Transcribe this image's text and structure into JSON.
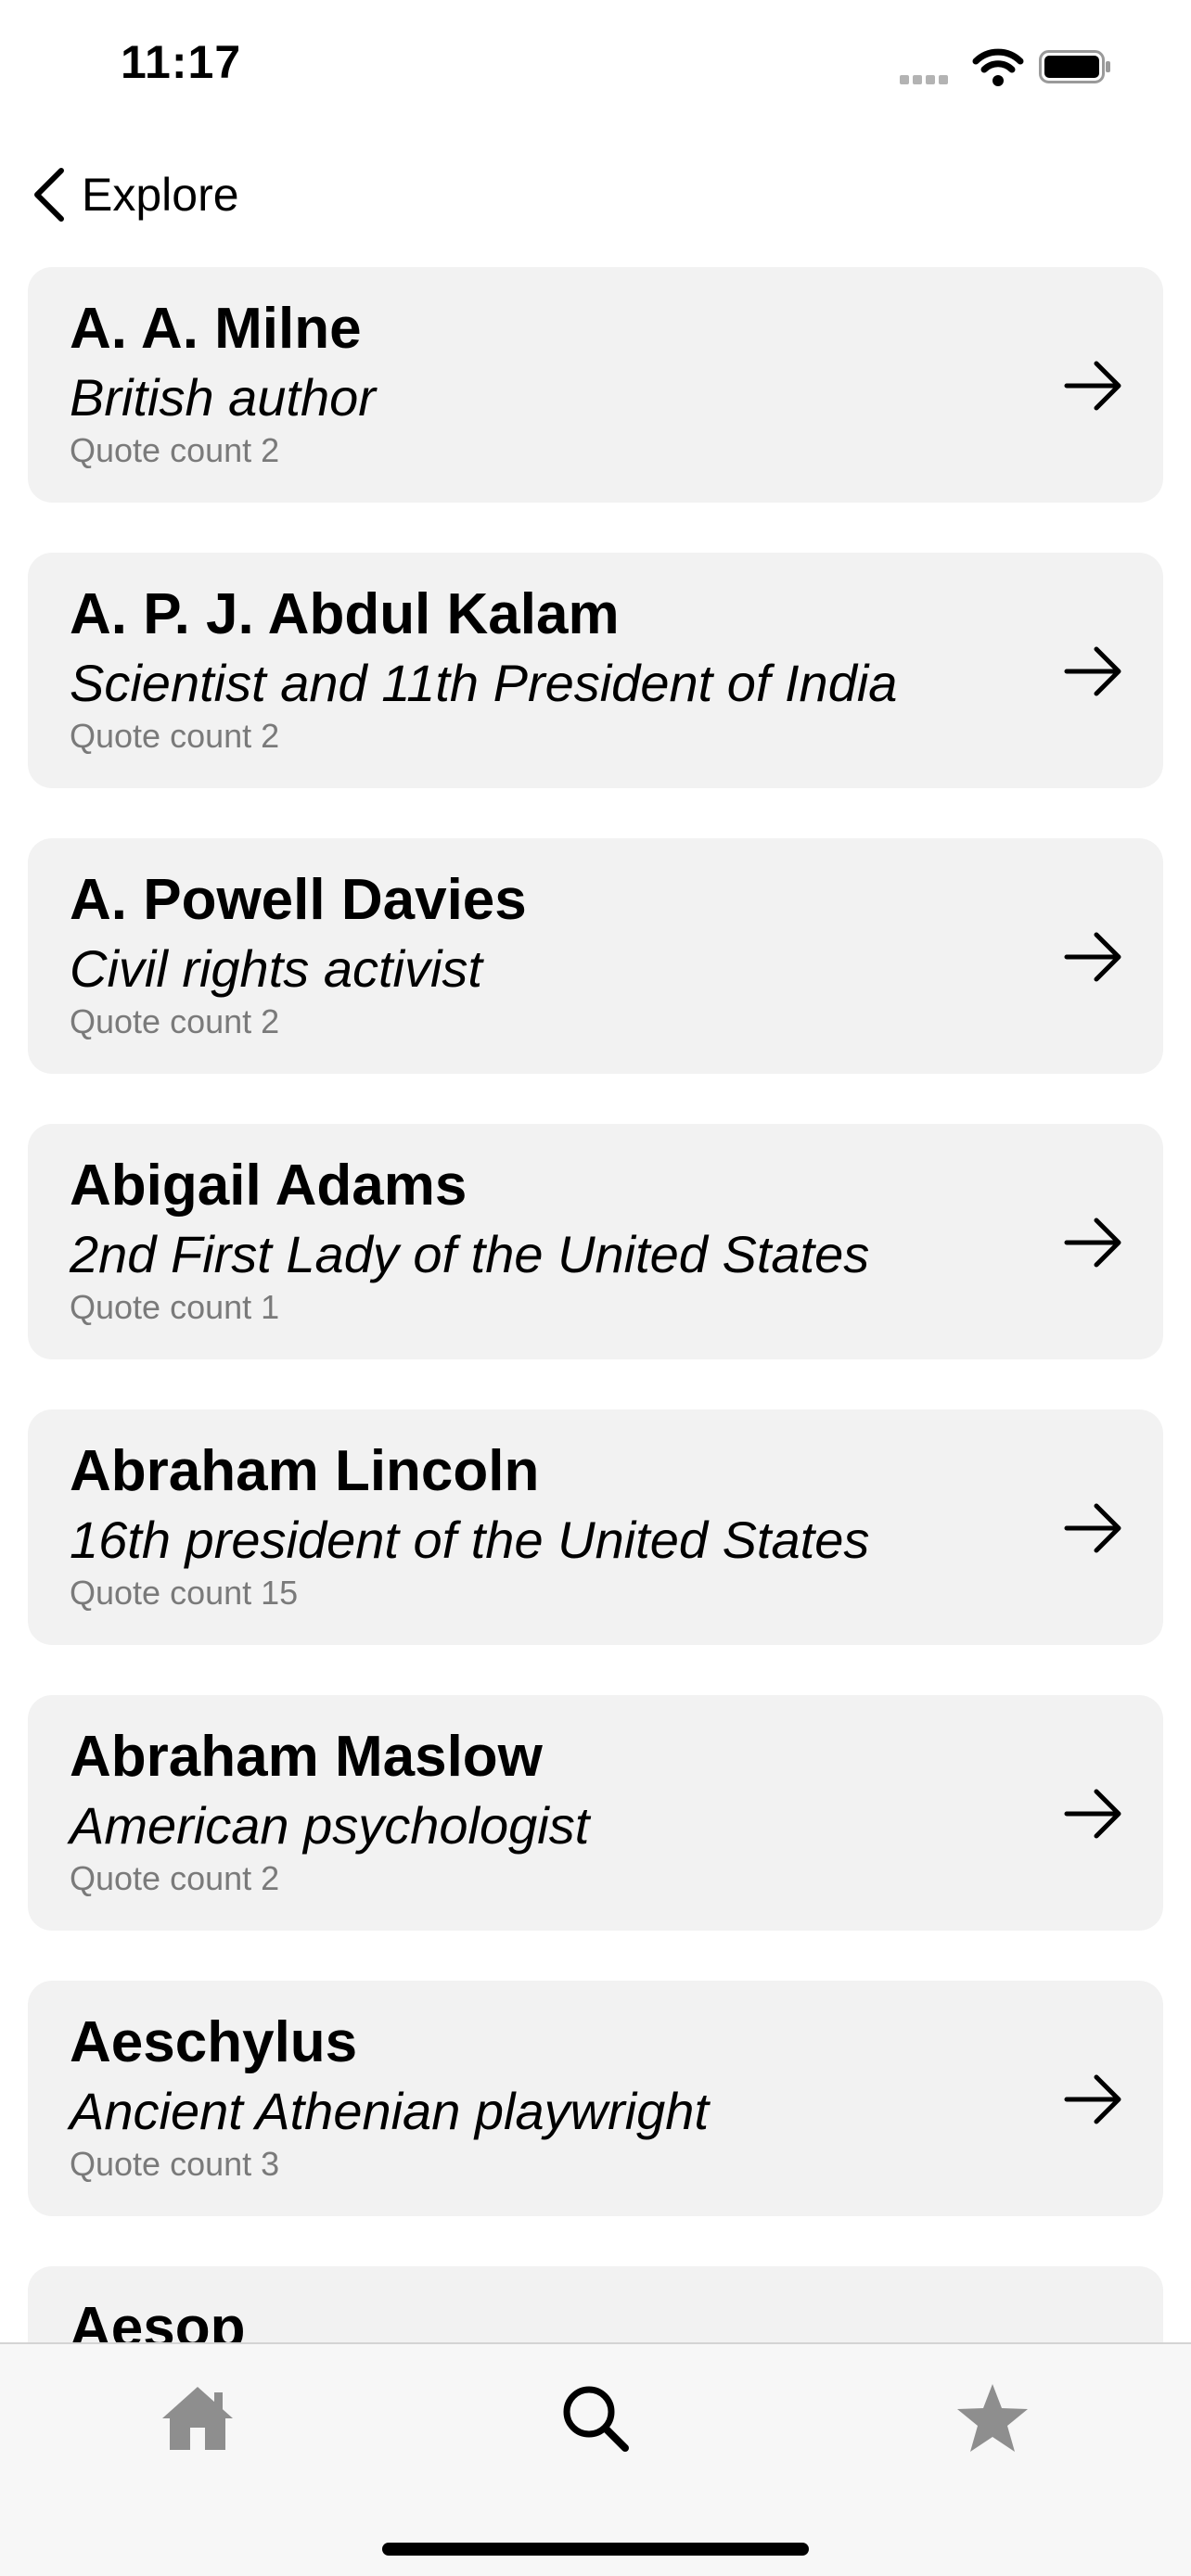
{
  "status_bar": {
    "time": "11:17"
  },
  "nav": {
    "back_label": "Explore"
  },
  "authors": [
    {
      "name": "A. A. Milne",
      "description": "British author",
      "quote_count": "Quote count 2"
    },
    {
      "name": "A. P. J. Abdul Kalam",
      "description": "Scientist and 11th President of India",
      "quote_count": "Quote count 2"
    },
    {
      "name": "A. Powell Davies",
      "description": "Civil rights activist",
      "quote_count": "Quote count 2"
    },
    {
      "name": "Abigail Adams",
      "description": "2nd First Lady of the United States",
      "quote_count": "Quote count 1"
    },
    {
      "name": "Abraham Lincoln",
      "description": "16th president of the United States",
      "quote_count": "Quote count 15"
    },
    {
      "name": "Abraham Maslow",
      "description": "American psychologist",
      "quote_count": "Quote count 2"
    },
    {
      "name": "Aeschylus",
      "description": "Ancient Athenian playwright",
      "quote_count": "Quote count 3"
    },
    {
      "name": "Aesop",
      "description": "",
      "quote_count": ""
    }
  ],
  "tab_bar": {
    "tabs": [
      {
        "icon": "house-icon",
        "color": "#8e8e8e"
      },
      {
        "icon": "magnifier-icon",
        "color": "#000000",
        "selected": true
      },
      {
        "icon": "star-icon",
        "color": "#8e8e8e"
      }
    ]
  }
}
